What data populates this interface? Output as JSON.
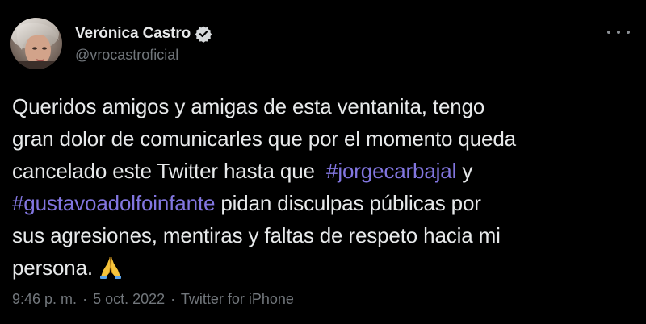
{
  "author": {
    "display_name": "Verónica Castro",
    "handle": "@vrocastroficial",
    "verified": true,
    "avatar_icon": "profile-photo"
  },
  "more_icon": "more-horizontal-icon",
  "tweet": {
    "lines": [
      {
        "segments": [
          {
            "text": "Queridos amigos y amigas de esta ventanita, tengo",
            "type": "text"
          }
        ]
      },
      {
        "segments": [
          {
            "text": "gran dolor de comunicarles que por el momento queda",
            "type": "text"
          }
        ]
      },
      {
        "segments": [
          {
            "text": "cancelado este Twitter hasta que  ",
            "type": "text"
          },
          {
            "text": "#jorgecarbajal",
            "type": "hashtag"
          },
          {
            "text": " y",
            "type": "text"
          }
        ]
      },
      {
        "segments": [
          {
            "text": "#gustavoadolfoinfante",
            "type": "hashtag"
          },
          {
            "text": " pidan disculpas públicas por",
            "type": "text"
          }
        ]
      },
      {
        "segments": [
          {
            "text": "sus agresiones, mentiras y faltas de respeto hacia mi",
            "type": "text"
          }
        ]
      },
      {
        "segments": [
          {
            "text": "persona.",
            "type": "text"
          }
        ]
      }
    ],
    "emoji": "folded-hands-icon"
  },
  "meta": {
    "time": "9:46 p. m.",
    "separator": "·",
    "date": "5 oct. 2022",
    "source": "Twitter for iPhone"
  },
  "colors": {
    "background": "#000000",
    "text": "#e7e9ea",
    "secondary": "#71767b",
    "hashtag": "#8276e0"
  }
}
